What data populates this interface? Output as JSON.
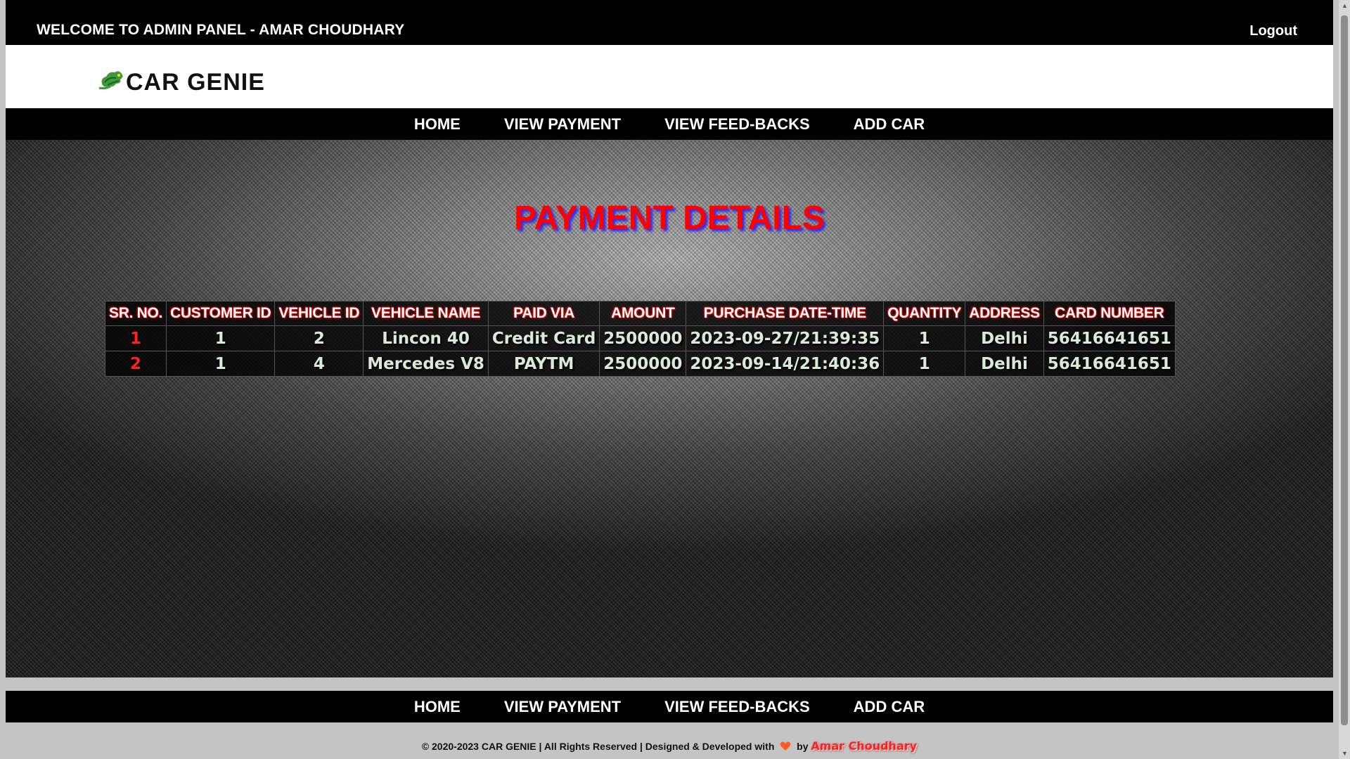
{
  "header": {
    "welcome": "WELCOME TO ADMIN PANEL - AMAR CHOUDHARY",
    "logout": "Logout"
  },
  "brand": {
    "logo_icon": "car-genie-logo-icon",
    "name": "CAR GENIE"
  },
  "nav": {
    "items": [
      "HOME",
      "VIEW PAYMENT",
      "VIEW FEED-BACKS",
      "ADD CAR"
    ]
  },
  "main": {
    "title": "PAYMENT DETAILS",
    "table": {
      "columns": [
        "SR. NO.",
        "CUSTOMER ID",
        "VEHICLE ID",
        "VEHICLE NAME",
        "PAID VIA",
        "AMOUNT",
        "PURCHASE DATE-TIME",
        "QUANTITY",
        "ADDRESS",
        "CARD NUMBER"
      ],
      "rows": [
        [
          "1",
          "1",
          "2",
          "Lincon 40",
          "Credit Card",
          "2500000",
          "2023-09-27/21:39:35",
          "1",
          "Delhi",
          "56416641651"
        ],
        [
          "2",
          "1",
          "4",
          "Mercedes V8",
          "PAYTM",
          "2500000",
          "2023-09-14/21:40:36",
          "1",
          "Delhi",
          "56416641651"
        ]
      ]
    }
  },
  "footer": {
    "text": "© 2020-2023 CAR GENIE | All Rights Reserved | Designed & Developed with",
    "heart_icon": "heart-icon",
    "by": "by",
    "author": "Amar Choudhary"
  },
  "colors": {
    "title_red": "#ff0000",
    "title_shadow": "#2b2bff",
    "bar_black": "#000000"
  }
}
